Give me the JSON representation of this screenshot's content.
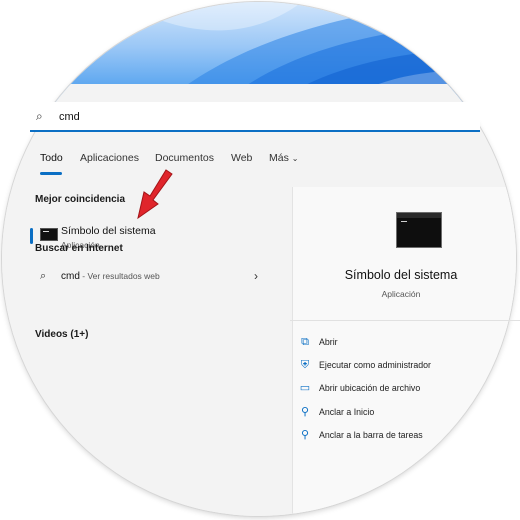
{
  "search": {
    "query": "cmd"
  },
  "tabs": [
    {
      "label": "Todo",
      "active": true
    },
    {
      "label": "Aplicaciones"
    },
    {
      "label": "Documentos"
    },
    {
      "label": "Web"
    },
    {
      "label": "Más"
    }
  ],
  "best_match": {
    "heading": "Mejor coincidencia",
    "title": "Símbolo del sistema",
    "subtitle": "Aplicación"
  },
  "web_search": {
    "heading": "Buscar en Internet",
    "term": "cmd",
    "hint": " - Ver resultados web"
  },
  "videos": {
    "heading": "Videos (1+)"
  },
  "details": {
    "name": "Símbolo del sistema",
    "type": "Aplicación",
    "actions": [
      {
        "label": "Abrir",
        "icon": "open-external-icon"
      },
      {
        "label": "Ejecutar como administrador",
        "icon": "shield-icon"
      },
      {
        "label": "Abrir ubicación de archivo",
        "icon": "folder-icon"
      },
      {
        "label": "Anclar a Inicio",
        "icon": "pin-icon"
      },
      {
        "label": "Anclar a la barra de tareas",
        "icon": "pin-icon"
      }
    ]
  },
  "colors": {
    "accent": "#0b6fc4",
    "annotation_arrow": "#e0252b"
  }
}
